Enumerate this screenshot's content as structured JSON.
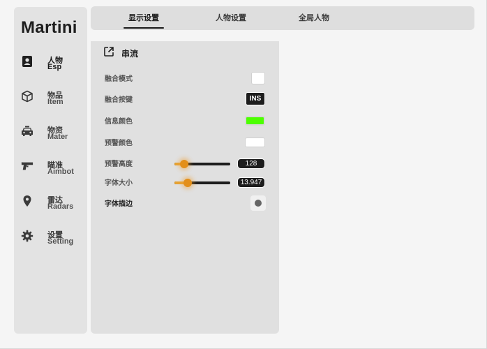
{
  "app": {
    "brand": "Martini"
  },
  "sidebar": {
    "items": [
      {
        "zh": "人物",
        "en": "Esp",
        "icon": "person-card-icon",
        "active": true
      },
      {
        "zh": "物品",
        "en": "Item",
        "icon": "cube-icon",
        "active": false
      },
      {
        "zh": "物资",
        "en": "Mater",
        "icon": "car-icon",
        "active": false
      },
      {
        "zh": "瞄准",
        "en": "Aimbot",
        "icon": "pistol-icon",
        "active": false
      },
      {
        "zh": "雷达",
        "en": "Radars",
        "icon": "location-pin-icon",
        "active": false
      },
      {
        "zh": "设置",
        "en": "Setting",
        "icon": "gear-icon",
        "active": false
      }
    ]
  },
  "tabs": [
    {
      "label": "显示设置",
      "active": true
    },
    {
      "label": "人物设置",
      "active": false
    },
    {
      "label": "全局人物",
      "active": false
    }
  ],
  "panel": {
    "title": "串流",
    "icon": "external-link-icon",
    "rows": {
      "blend_mode": {
        "label": "融合模式",
        "color": "#ffffff"
      },
      "blend_key": {
        "label": "融合按键",
        "key": "INS"
      },
      "info_color": {
        "label": "信息颜色",
        "color": "#4cff00"
      },
      "warn_color": {
        "label": "预警颜色",
        "color": "#ffffff"
      },
      "warn_height": {
        "label": "预警高度",
        "value": "128",
        "fraction": 0.18
      },
      "font_size": {
        "label": "字体大小",
        "value": "13.947",
        "fraction": 0.24
      },
      "font_stroke": {
        "label": "字体描边",
        "checked": true
      }
    }
  },
  "colors": {
    "accent": "#e6a232",
    "dark": "#1d1d1d"
  }
}
